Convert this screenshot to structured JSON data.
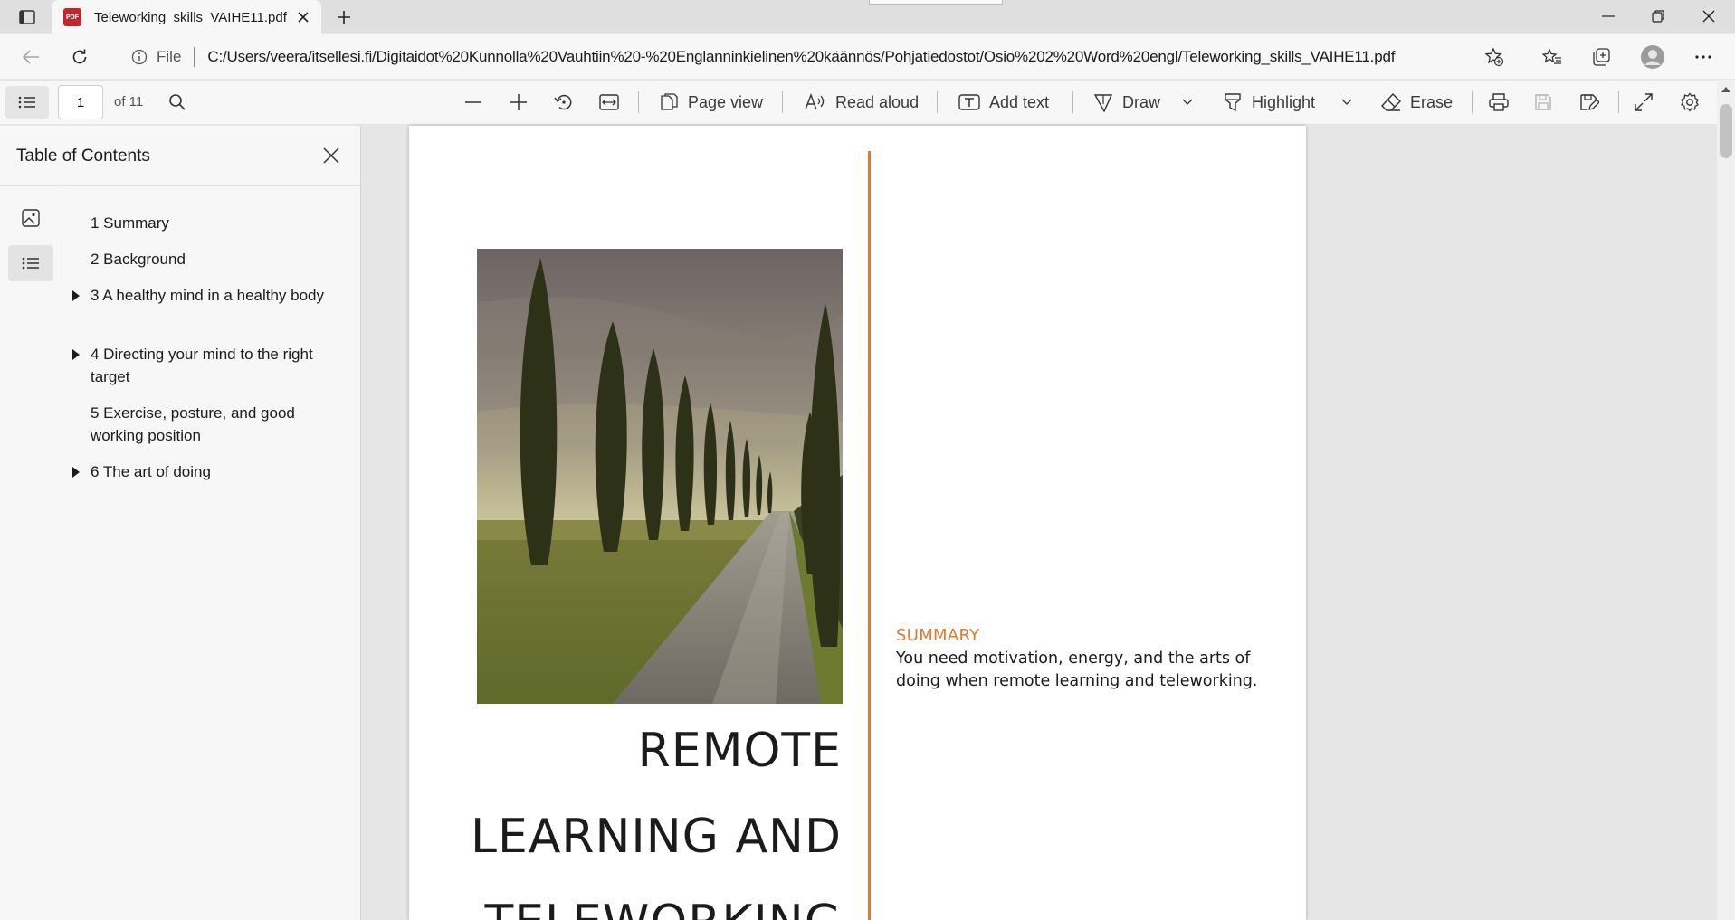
{
  "browser": {
    "tab": {
      "title": "Teleworking_skills_VAIHE11.pdf",
      "badge": "PDF"
    },
    "address": {
      "scheme": "File",
      "url": "C:/Users/veera/itsellesi.fi/Digitaidot%20Kunnolla%20Vauhtiin%20-%20Englanninkielinen%20käännös/Pohjatiedostot/Osio%202%20Word%20engl/Teleworking_skills_VAIHE11.pdf"
    }
  },
  "pdf_toolbar": {
    "page_current": "1",
    "page_total": "of 11",
    "page_view": "Page view",
    "read_aloud": "Read aloud",
    "add_text": "Add text",
    "draw": "Draw",
    "highlight": "Highlight",
    "erase": "Erase"
  },
  "sidebar": {
    "title": "Table of Contents",
    "items": [
      {
        "label": "1 Summary",
        "expandable": false
      },
      {
        "label": "2 Background",
        "expandable": false
      },
      {
        "label": "3 A healthy mind in a healthy body",
        "expandable": true
      },
      {
        "label": "4 Directing your mind to the right target",
        "expandable": true
      },
      {
        "label": "5 Exercise, posture, and good working position",
        "expandable": false
      },
      {
        "label": "6 The art of doing",
        "expandable": true
      }
    ]
  },
  "document": {
    "summary_heading": "SUMMARY",
    "summary_text": "You need motivation, energy, and the arts of doing when remote learning and teleworking.",
    "title_lines": [
      "REMOTE",
      "LEARNING AND",
      "TELEWORKING"
    ]
  },
  "colors": {
    "accent": "#e8772e",
    "pdf_badge": "#c4262e"
  }
}
